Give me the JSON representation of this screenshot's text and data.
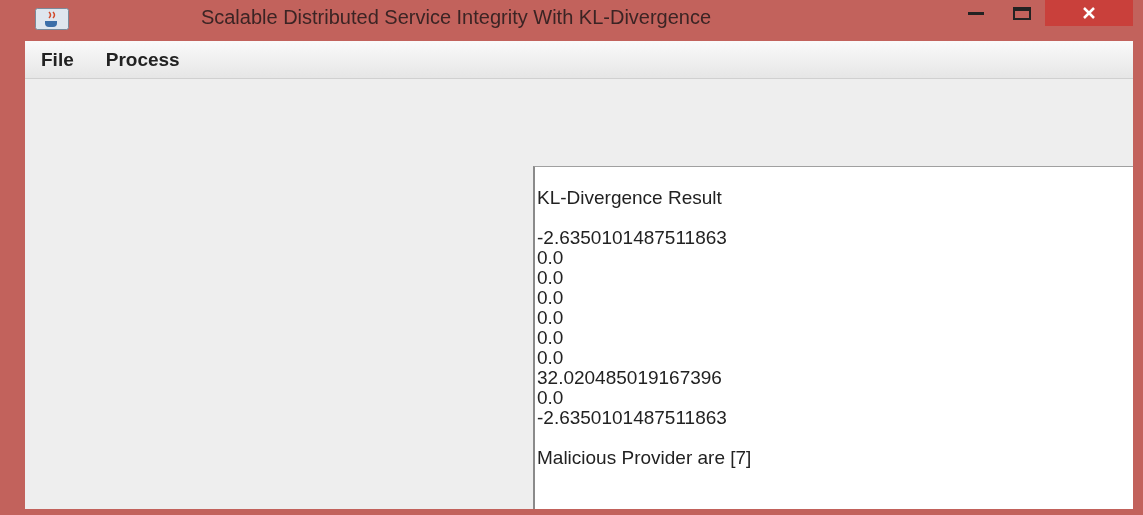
{
  "window": {
    "title": "Scalable Distributed Service Integrity With KL-Divergence"
  },
  "menu": [
    "File",
    "Process"
  ],
  "result": {
    "heading": "KL-Divergence Result",
    "values": [
      "-2.6350101487511863",
      "0.0",
      "0.0",
      "0.0",
      "0.0",
      "0.0",
      "0.0",
      "32.020485019167396",
      "0.0",
      "-2.6350101487511863"
    ],
    "summary": "Malicious Provider are [7]"
  }
}
